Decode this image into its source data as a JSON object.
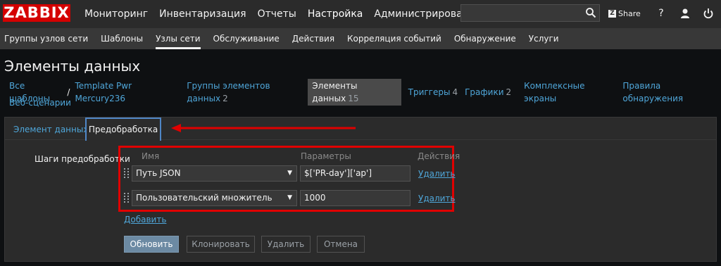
{
  "brand": "ZABBIX",
  "main_nav": [
    "Мониторинг",
    "Инвентаризация",
    "Отчеты",
    "Настройка",
    "Администрирование"
  ],
  "share_label": "Share",
  "icons": {
    "search": "search-icon",
    "help": "help-icon",
    "user": "user-icon",
    "logout": "power-icon"
  },
  "sub_nav": [
    "Группы узлов сети",
    "Шаблоны",
    "Узлы сети",
    "Обслуживание",
    "Действия",
    "Корреляция событий",
    "Обнаружение",
    "Услуги"
  ],
  "page_title": "Элементы данных",
  "host_nav": {
    "all_templates": "Все шаблоны",
    "separator": "/",
    "template": "Template Pwr Mercury236",
    "item_groups": "Группы элементов данных",
    "item_groups_count": "2",
    "items": "Элементы данных",
    "items_count": "15",
    "triggers": "Триггеры",
    "triggers_count": "4",
    "graphs": "Графики",
    "graphs_count": "2",
    "screens": "Комплексные экраны",
    "discovery": "Правила обнаружения",
    "web": "Веб-сценарии"
  },
  "tabs": {
    "item": "Элемент данных",
    "preprocessing": "Предобработка"
  },
  "form": {
    "steps_label": "Шаги предобработки",
    "col_name": "Имя",
    "col_params": "Параметры",
    "col_actions": "Действия",
    "steps": [
      {
        "type": "Путь JSON",
        "param": "$['PR-day']['ap']",
        "remove": "Удалить"
      },
      {
        "type": "Пользовательский множитель",
        "param": "1000",
        "remove": "Удалить"
      }
    ],
    "add": "Добавить"
  },
  "buttons": {
    "update": "Обновить",
    "clone": "Клонировать",
    "delete": "Удалить",
    "cancel": "Отмена"
  },
  "colors": {
    "brand_red": "#d40000",
    "link": "#4fa6d9",
    "highlight_red": "#e00000",
    "primary_button": "#6c8aa3"
  }
}
